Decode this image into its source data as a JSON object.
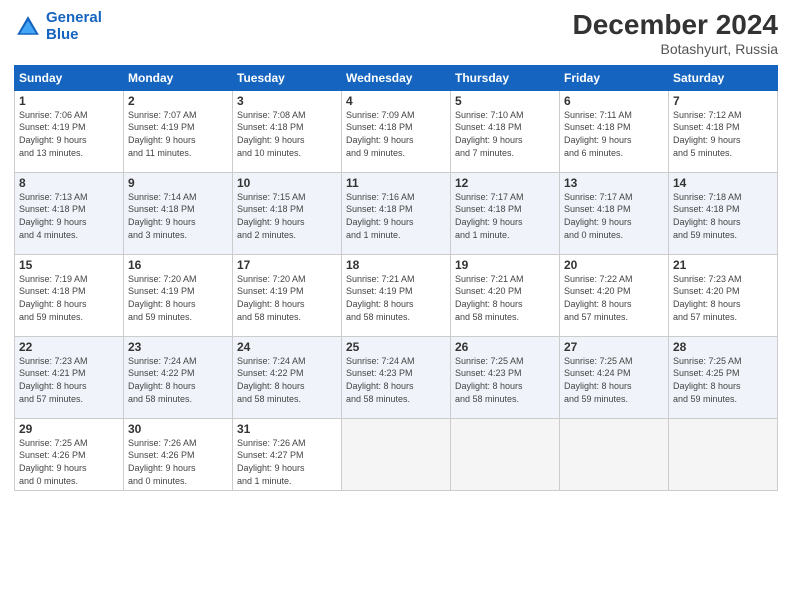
{
  "logo": {
    "line1": "General",
    "line2": "Blue"
  },
  "title": "December 2024",
  "subtitle": "Botashyurt, Russia",
  "weekdays": [
    "Sunday",
    "Monday",
    "Tuesday",
    "Wednesday",
    "Thursday",
    "Friday",
    "Saturday"
  ],
  "weeks": [
    [
      {
        "day": "1",
        "info": "Sunrise: 7:06 AM\nSunset: 4:19 PM\nDaylight: 9 hours\nand 13 minutes."
      },
      {
        "day": "2",
        "info": "Sunrise: 7:07 AM\nSunset: 4:19 PM\nDaylight: 9 hours\nand 11 minutes."
      },
      {
        "day": "3",
        "info": "Sunrise: 7:08 AM\nSunset: 4:18 PM\nDaylight: 9 hours\nand 10 minutes."
      },
      {
        "day": "4",
        "info": "Sunrise: 7:09 AM\nSunset: 4:18 PM\nDaylight: 9 hours\nand 9 minutes."
      },
      {
        "day": "5",
        "info": "Sunrise: 7:10 AM\nSunset: 4:18 PM\nDaylight: 9 hours\nand 7 minutes."
      },
      {
        "day": "6",
        "info": "Sunrise: 7:11 AM\nSunset: 4:18 PM\nDaylight: 9 hours\nand 6 minutes."
      },
      {
        "day": "7",
        "info": "Sunrise: 7:12 AM\nSunset: 4:18 PM\nDaylight: 9 hours\nand 5 minutes."
      }
    ],
    [
      {
        "day": "8",
        "info": "Sunrise: 7:13 AM\nSunset: 4:18 PM\nDaylight: 9 hours\nand 4 minutes."
      },
      {
        "day": "9",
        "info": "Sunrise: 7:14 AM\nSunset: 4:18 PM\nDaylight: 9 hours\nand 3 minutes."
      },
      {
        "day": "10",
        "info": "Sunrise: 7:15 AM\nSunset: 4:18 PM\nDaylight: 9 hours\nand 2 minutes."
      },
      {
        "day": "11",
        "info": "Sunrise: 7:16 AM\nSunset: 4:18 PM\nDaylight: 9 hours\nand 1 minute."
      },
      {
        "day": "12",
        "info": "Sunrise: 7:17 AM\nSunset: 4:18 PM\nDaylight: 9 hours\nand 1 minute."
      },
      {
        "day": "13",
        "info": "Sunrise: 7:17 AM\nSunset: 4:18 PM\nDaylight: 9 hours\nand 0 minutes."
      },
      {
        "day": "14",
        "info": "Sunrise: 7:18 AM\nSunset: 4:18 PM\nDaylight: 8 hours\nand 59 minutes."
      }
    ],
    [
      {
        "day": "15",
        "info": "Sunrise: 7:19 AM\nSunset: 4:18 PM\nDaylight: 8 hours\nand 59 minutes."
      },
      {
        "day": "16",
        "info": "Sunrise: 7:20 AM\nSunset: 4:19 PM\nDaylight: 8 hours\nand 59 minutes."
      },
      {
        "day": "17",
        "info": "Sunrise: 7:20 AM\nSunset: 4:19 PM\nDaylight: 8 hours\nand 58 minutes."
      },
      {
        "day": "18",
        "info": "Sunrise: 7:21 AM\nSunset: 4:19 PM\nDaylight: 8 hours\nand 58 minutes."
      },
      {
        "day": "19",
        "info": "Sunrise: 7:21 AM\nSunset: 4:20 PM\nDaylight: 8 hours\nand 58 minutes."
      },
      {
        "day": "20",
        "info": "Sunrise: 7:22 AM\nSunset: 4:20 PM\nDaylight: 8 hours\nand 57 minutes."
      },
      {
        "day": "21",
        "info": "Sunrise: 7:23 AM\nSunset: 4:20 PM\nDaylight: 8 hours\nand 57 minutes."
      }
    ],
    [
      {
        "day": "22",
        "info": "Sunrise: 7:23 AM\nSunset: 4:21 PM\nDaylight: 8 hours\nand 57 minutes."
      },
      {
        "day": "23",
        "info": "Sunrise: 7:24 AM\nSunset: 4:22 PM\nDaylight: 8 hours\nand 58 minutes."
      },
      {
        "day": "24",
        "info": "Sunrise: 7:24 AM\nSunset: 4:22 PM\nDaylight: 8 hours\nand 58 minutes."
      },
      {
        "day": "25",
        "info": "Sunrise: 7:24 AM\nSunset: 4:23 PM\nDaylight: 8 hours\nand 58 minutes."
      },
      {
        "day": "26",
        "info": "Sunrise: 7:25 AM\nSunset: 4:23 PM\nDaylight: 8 hours\nand 58 minutes."
      },
      {
        "day": "27",
        "info": "Sunrise: 7:25 AM\nSunset: 4:24 PM\nDaylight: 8 hours\nand 59 minutes."
      },
      {
        "day": "28",
        "info": "Sunrise: 7:25 AM\nSunset: 4:25 PM\nDaylight: 8 hours\nand 59 minutes."
      }
    ],
    [
      {
        "day": "29",
        "info": "Sunrise: 7:25 AM\nSunset: 4:26 PM\nDaylight: 9 hours\nand 0 minutes."
      },
      {
        "day": "30",
        "info": "Sunrise: 7:26 AM\nSunset: 4:26 PM\nDaylight: 9 hours\nand 0 minutes."
      },
      {
        "day": "31",
        "info": "Sunrise: 7:26 AM\nSunset: 4:27 PM\nDaylight: 9 hours\nand 1 minute."
      },
      null,
      null,
      null,
      null
    ]
  ]
}
